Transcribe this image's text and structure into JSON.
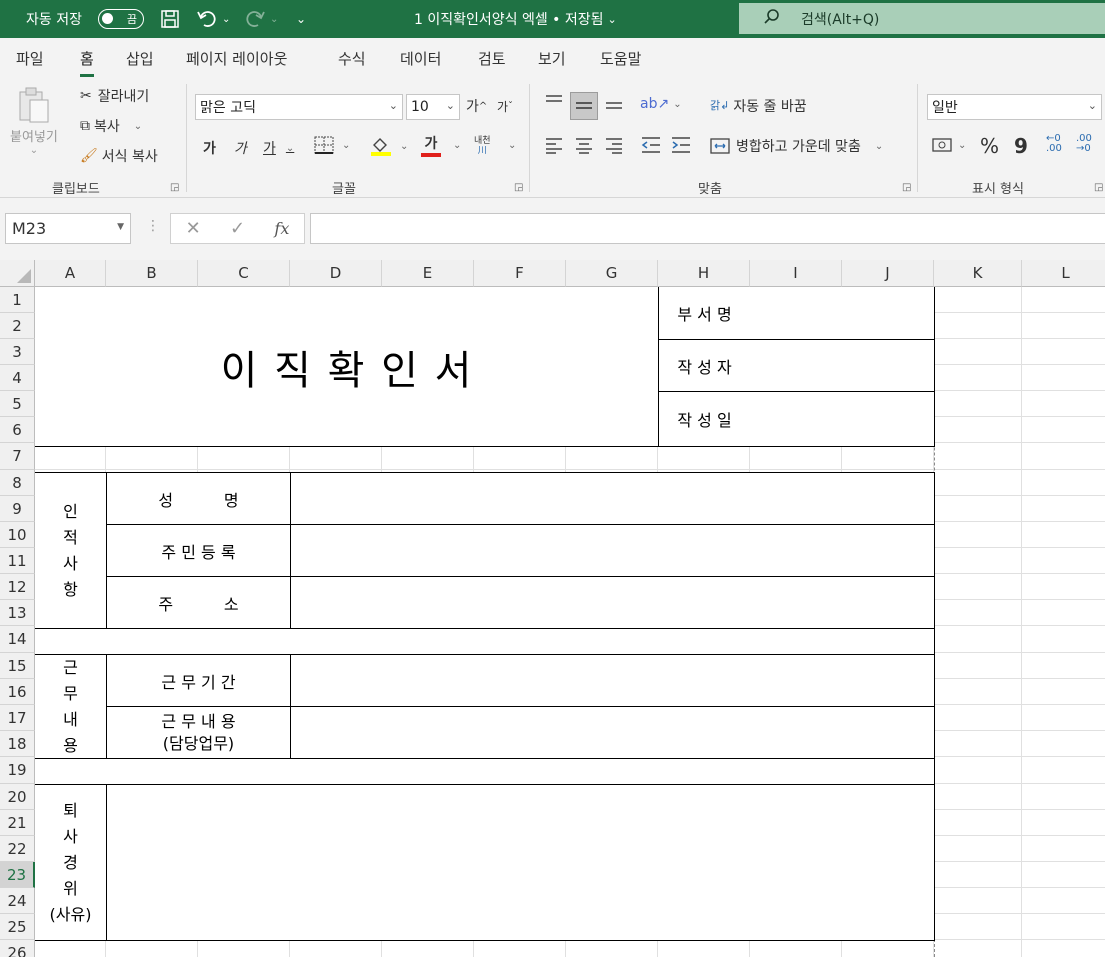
{
  "titlebar": {
    "autosave_label": "자동 저장",
    "autosave_state": "끔",
    "doc_title": "1 이직확인서양식 엑셀 • 저장됨",
    "search_placeholder": "검색(Alt+Q)"
  },
  "tabs": [
    "파일",
    "홈",
    "삽입",
    "페이지 레이아웃",
    "수식",
    "데이터",
    "검토",
    "보기",
    "도움말"
  ],
  "active_tab": "홈",
  "ribbon": {
    "clipboard": {
      "paste": "붙여넣기",
      "cut": "잘라내기",
      "copy": "복사",
      "format_painter": "서식 복사",
      "label": "클립보드"
    },
    "font": {
      "name": "맑은 고딕",
      "size": "10",
      "grow": "가",
      "shrink": "가",
      "bold": "가",
      "italic": "가",
      "underline": "가",
      "color_a": "가",
      "phonetic": "내천",
      "label": "글꼴"
    },
    "align": {
      "wrap_text": "자동 줄 바꿈",
      "merge_center": "병합하고 가운데 맞춤",
      "label": "맞춤"
    },
    "number": {
      "format": "일반",
      "percent": "%",
      "comma": "9",
      "label": "표시 형식"
    }
  },
  "formula_bar": {
    "name_box": "M23",
    "cancel": "✕",
    "enter": "✓",
    "fx": "fx",
    "formula": ""
  },
  "columns": [
    "A",
    "B",
    "C",
    "D",
    "E",
    "F",
    "G",
    "H",
    "I",
    "J",
    "K",
    "L"
  ],
  "rows": [
    "1",
    "2",
    "3",
    "4",
    "5",
    "6",
    "7",
    "8",
    "9",
    "10",
    "11",
    "12",
    "13",
    "14",
    "15",
    "16",
    "17",
    "18",
    "19",
    "20",
    "21",
    "22",
    "23",
    "24",
    "25",
    "26"
  ],
  "selected_row": "23",
  "sheet": {
    "title": "이 직 확 인 서",
    "approval": {
      "dept": "부 서 명",
      "author": "작 성 자",
      "date": "작 성 일"
    },
    "personal": {
      "section": "인\n적\n사\n항",
      "name": "성          명",
      "resident_no": "주 민 등 록",
      "address": "주          소"
    },
    "work": {
      "section": "근\n무\n내\n용",
      "period": "근 무 기 간",
      "content": "근 무 내 용\n(담당업무)"
    },
    "resign": {
      "section": "퇴\n사\n경\n위\n(사유)"
    }
  }
}
